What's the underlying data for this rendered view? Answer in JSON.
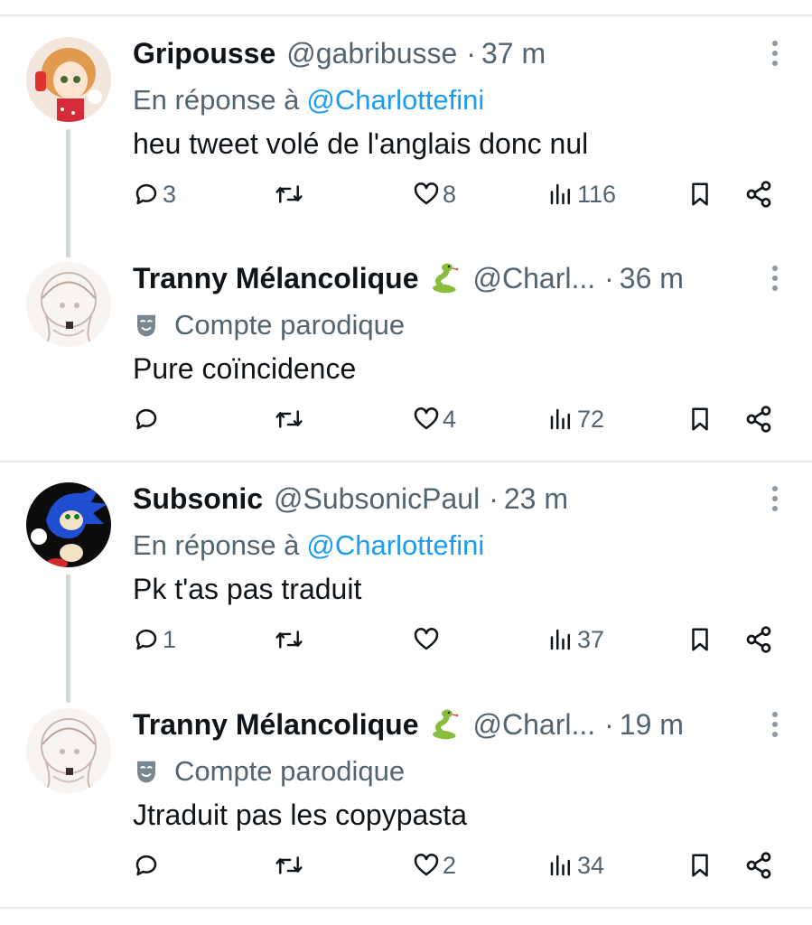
{
  "colors": {
    "link": "#1d9bf0",
    "muted": "#536471",
    "text": "#0f1419",
    "divider": "#e6e9ec",
    "thread": "#cfd9de"
  },
  "tweets": [
    {
      "name": "Gripousse",
      "handle": "@gabribusse",
      "time": "37 m",
      "reply_prefix": "En réponse à",
      "reply_to": "@Charlottefini",
      "text": "heu tweet volé de l'anglais donc nul",
      "replies": "3",
      "retweets": "",
      "likes": "8",
      "views": "116",
      "avatar": "anime-avatar-icon"
    },
    {
      "name": "Tranny Mélancolique",
      "emoji": "snake-emoji-icon",
      "handle": "@Charl...",
      "time": "36 m",
      "badge": "Compte parodique",
      "text": "Pure coïncidence",
      "replies": "",
      "retweets": "",
      "likes": "4",
      "views": "72",
      "avatar": "sketch-avatar-icon"
    },
    {
      "name": "Subsonic",
      "handle": "@SubsonicPaul",
      "time": "23 m",
      "reply_prefix": "En réponse à",
      "reply_to": "@Charlottefini",
      "text": "Pk t'as pas traduit",
      "replies": "1",
      "retweets": "",
      "likes": "",
      "views": "37",
      "avatar": "sonic-avatar-icon"
    },
    {
      "name": "Tranny Mélancolique",
      "emoji": "snake-emoji-icon",
      "handle": "@Charl...",
      "time": "19 m",
      "badge": "Compte parodique",
      "text": "Jtraduit pas les copypasta",
      "replies": "",
      "retweets": "",
      "likes": "2",
      "views": "34",
      "avatar": "sketch-avatar-icon"
    }
  ]
}
